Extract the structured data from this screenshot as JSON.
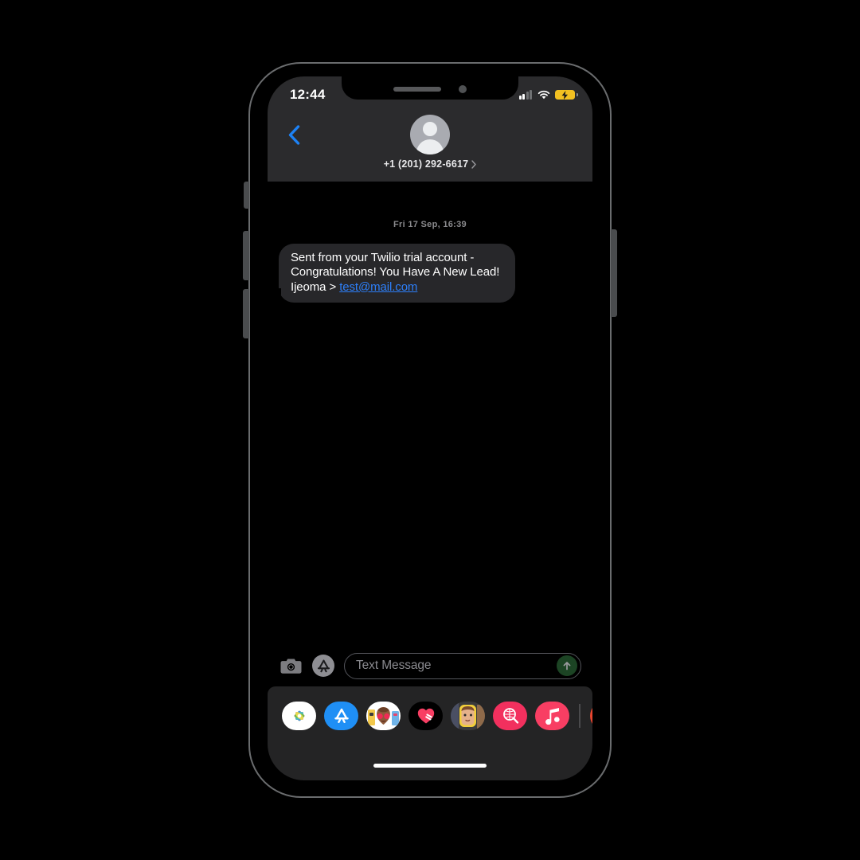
{
  "device": {
    "name": "iPhone",
    "frame_color": "#6a6c6e",
    "screen_background": "#000000",
    "buttons": {
      "silence_switch": "silence-switch",
      "volume_up": "volume-up-button",
      "volume_down": "volume-down-button",
      "power": "power-button"
    },
    "notch": {
      "speaker": "speaker-grille",
      "camera": "front-camera"
    },
    "home_indicator": "home-indicator"
  },
  "status_bar": {
    "time": "12:44",
    "cellular_bars_filled": 2,
    "cellular_bars_total": 4,
    "wifi_icon": "wifi-icon",
    "battery_icon": "battery-charging-icon",
    "battery_color": "#f2c021",
    "battery_charging": true
  },
  "nav_header": {
    "background": "#2b2b2d",
    "back_icon": "chevron-left-icon",
    "back_color": "#1d82f5",
    "contact": {
      "avatar_icon": "person-avatar-icon",
      "name": "+1 (201) 292-6617",
      "chevron": "›"
    }
  },
  "conversation": {
    "timestamp": "Fri 17 Sep, 16:39",
    "messages": [
      {
        "sender": "incoming",
        "bubble_color": "#27272a",
        "text_before_link": "Sent from your Twilio trial account - Congratulations! You Have A New Lead! Ijeoma > ",
        "link_text": "test@mail.com",
        "link_color": "#2d7ff9"
      }
    ]
  },
  "input_toolbar": {
    "camera_icon": "camera-icon",
    "appstore_icon": "app-store-icon",
    "placeholder": "Text Message",
    "value": "",
    "send_icon": "arrow-up-icon",
    "send_color": "#1c4424",
    "send_enabled": false
  },
  "app_drawer": {
    "background": "#242425",
    "apps": [
      {
        "name": "Photos",
        "icon": "photos-icon",
        "color": "#ffffff"
      },
      {
        "name": "App Store",
        "icon": "app-store-icon",
        "color": "#1f8ff5"
      },
      {
        "name": "Stickers",
        "icon": "stickers-icon",
        "color": "#ffffff"
      },
      {
        "name": "Fitness",
        "icon": "fitness-icon",
        "color": "#000000"
      },
      {
        "name": "Memoji",
        "icon": "memoji-icon",
        "color": "#3a3a3c"
      },
      {
        "name": "#images",
        "icon": "images-search-icon",
        "color": "#f2305e"
      },
      {
        "name": "Music",
        "icon": "music-note-icon",
        "color": "#f83e63"
      },
      {
        "name": "More",
        "icon": "overflow-app-icon",
        "color": "#e8452f"
      }
    ]
  }
}
